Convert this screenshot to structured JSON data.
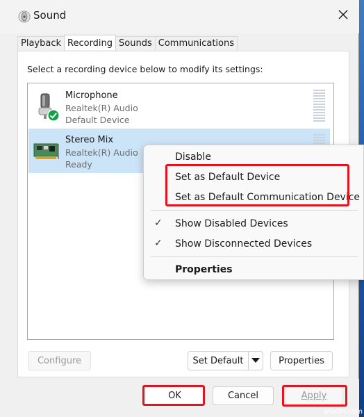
{
  "window": {
    "title": "Sound",
    "close_icon": "close-icon"
  },
  "tabs": [
    {
      "label": "Playback"
    },
    {
      "label": "Recording"
    },
    {
      "label": "Sounds"
    },
    {
      "label": "Communications"
    }
  ],
  "active_tab": "Recording",
  "instruction": "Select a recording device below to modify its settings:",
  "devices": [
    {
      "name": "Microphone",
      "driver": "Realtek(R) Audio",
      "status": "Default Device",
      "icon": "microphone-icon",
      "badge": "green-check-icon"
    },
    {
      "name": "Stereo Mix",
      "driver": "Realtek(R) Audio",
      "status": "Ready",
      "icon": "sound-card-icon"
    }
  ],
  "buttons": {
    "configure": "Configure",
    "set_default": "Set Default",
    "properties": "Properties",
    "ok": "OK",
    "cancel": "Cancel",
    "apply": "Apply"
  },
  "context_menu": {
    "items": [
      {
        "label": "Disable"
      },
      {
        "label": "Set as Default Device"
      },
      {
        "label": "Set as Default Communication Device"
      },
      {
        "label": "Show Disabled Devices",
        "checked": true
      },
      {
        "label": "Show Disconnected Devices",
        "checked": true
      },
      {
        "label": "Properties",
        "bold": true
      }
    ]
  },
  "colors": {
    "selection": "#cce4f7",
    "highlight": "#e2141f",
    "default_check": "#10a04a"
  },
  "watermark": "wsxdn.com"
}
